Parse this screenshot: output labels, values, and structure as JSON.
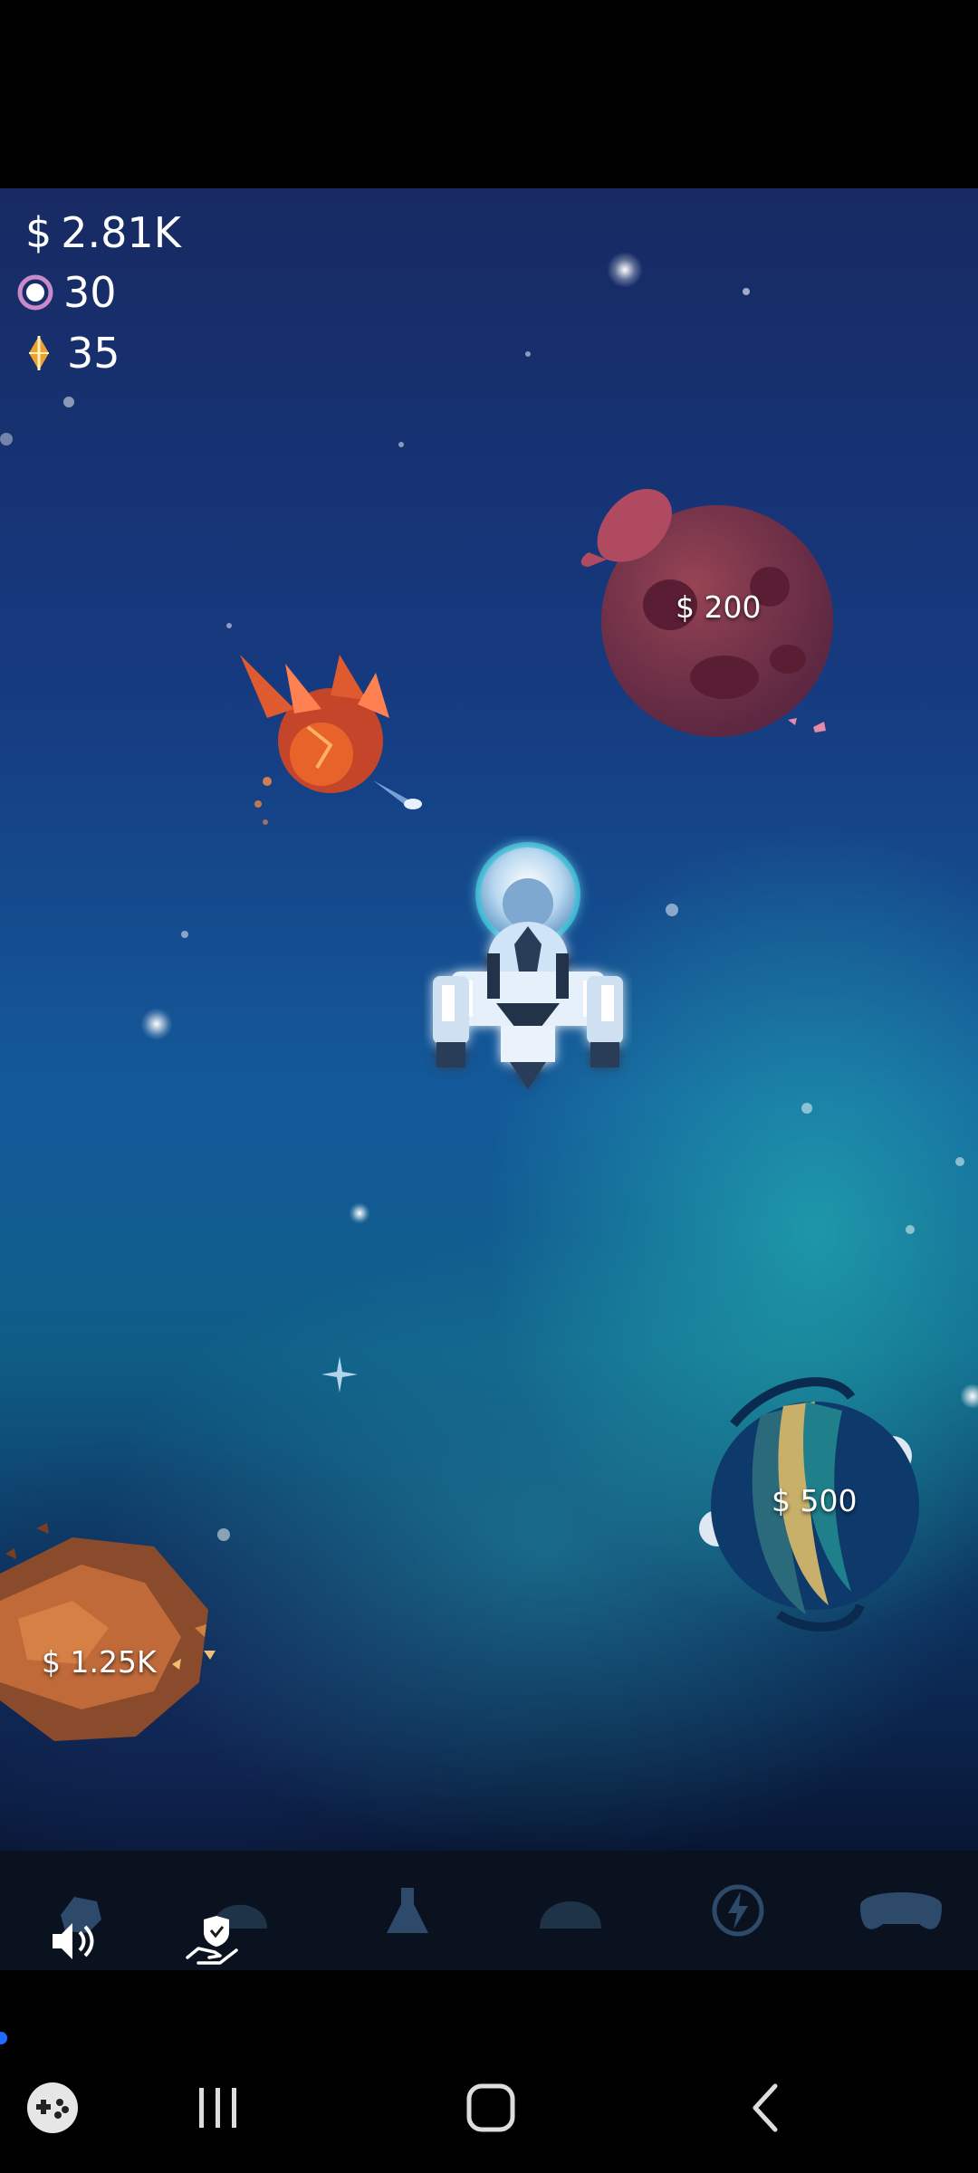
{
  "hud": {
    "money": "2.81K",
    "money_symbol": "$",
    "gems": "30",
    "fuel": "35"
  },
  "planets": {
    "red_planet_price": "$ 200",
    "blue_planet_price": "$ 500",
    "rock_planet_price": "$ 1.25K"
  },
  "bottom_tabs": [
    "mining-rig-icon",
    "dome-icon",
    "flask-icon",
    "helmet-icon",
    "lightning-icon",
    "gamepad-icon"
  ],
  "toolbar": [
    "speaker-icon",
    "hand-shield-icon"
  ],
  "system_nav": [
    "game-launcher-icon",
    "recent-apps-icon",
    "home-icon",
    "back-icon"
  ],
  "colors": {
    "gem_purple": "#c98ac9",
    "fuel_orange": "#f0a030",
    "tab_inactive": "#1f3348",
    "tab_active": "#2d4a6b"
  }
}
